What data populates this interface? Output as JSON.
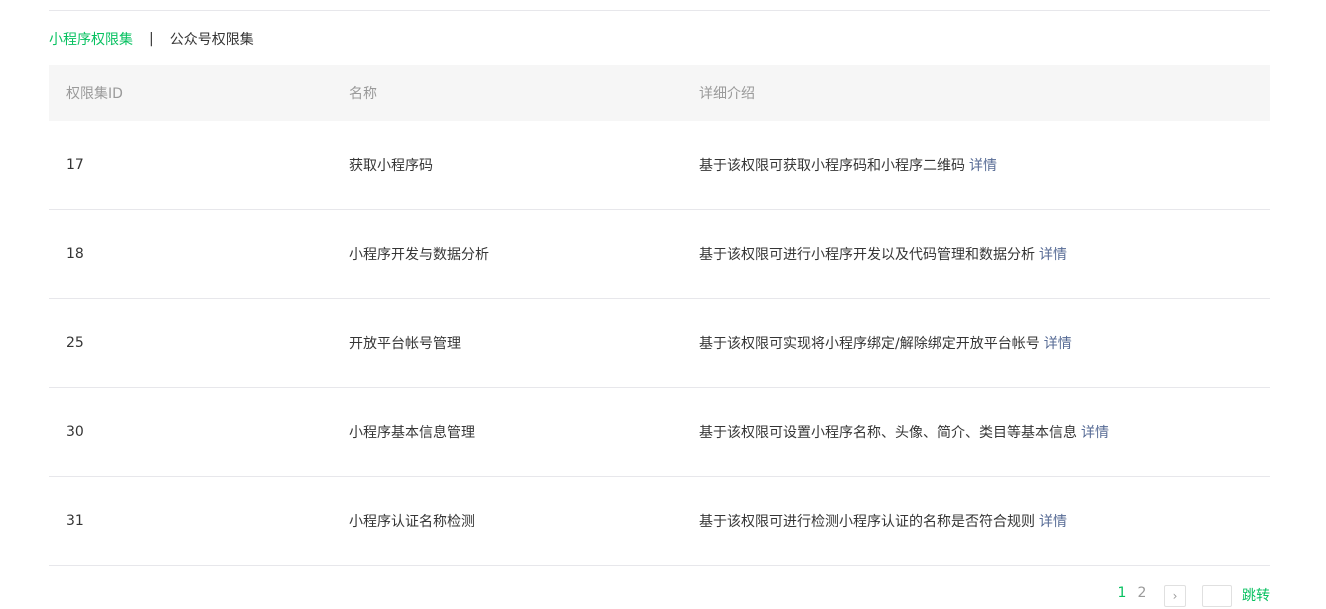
{
  "tabs": [
    {
      "label": "小程序权限集",
      "active": true
    },
    {
      "label": "公众号权限集",
      "active": false
    }
  ],
  "tab_separator": "|",
  "table": {
    "headers": [
      "权限集ID",
      "名称",
      "详细介绍"
    ],
    "detail_link": "详情",
    "rows": [
      {
        "id": "17",
        "name": "获取小程序码",
        "desc": "基于该权限可获取小程序码和小程序二维码"
      },
      {
        "id": "18",
        "name": "小程序开发与数据分析",
        "desc": "基于该权限可进行小程序开发以及代码管理和数据分析"
      },
      {
        "id": "25",
        "name": "开放平台帐号管理",
        "desc": "基于该权限可实现将小程序绑定/解除绑定开放平台帐号"
      },
      {
        "id": "30",
        "name": "小程序基本信息管理",
        "desc": "基于该权限可设置小程序名称、头像、简介、类目等基本信息"
      },
      {
        "id": "31",
        "name": "小程序认证名称检测",
        "desc": "基于该权限可进行检测小程序认证的名称是否符合规则"
      }
    ]
  },
  "pagination": {
    "pages": [
      "1",
      "2"
    ],
    "current": "1",
    "next_icon": "chevron-right-icon",
    "jump_label": "跳转"
  },
  "colors": {
    "accent": "#07c160",
    "link": "#576b95",
    "header_bg": "#f6f6f6",
    "border": "#e7e7eb"
  }
}
